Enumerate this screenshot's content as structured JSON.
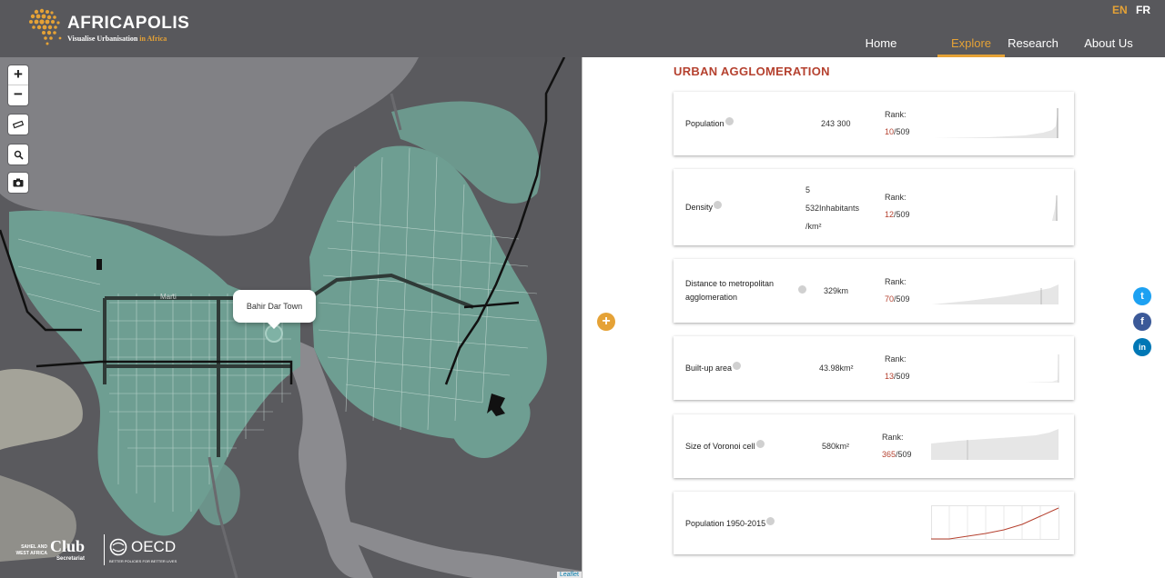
{
  "header": {
    "logo_title": "AFRICAPOLIS",
    "logo_sub_main": "Visualise Urbanisation",
    "logo_sub_highlight": "in Africa",
    "lang_active": "EN",
    "lang_other": "FR",
    "nav": [
      {
        "label": "Home"
      },
      {
        "label": "Explore"
      },
      {
        "label": "Research"
      },
      {
        "label": "About Us"
      }
    ]
  },
  "map": {
    "zoom_in": "+",
    "zoom_out": "−",
    "popup_label": "Bahir Dar Town",
    "road_label": "Marti",
    "attribution": "Leaflet",
    "partner_small": "SAHEL AND WEST AFRICA",
    "partner_club": "Club",
    "partner_secretariat": "Secretariat",
    "partner_oecd": "OECD",
    "partner_oecd_sub": "BETTER POLICIES FOR BETTER LIVES",
    "colors": {
      "background": "#5a5a5e",
      "urban": "#6e9e92",
      "roads": "#d7e7e1",
      "water": "#8b8b8f"
    }
  },
  "panel": {
    "title": "URBAN AGGLOMERATION",
    "toggle": "+",
    "rank_label": "Rank:",
    "cards": [
      {
        "label": "Population",
        "value": "243 300",
        "rank": "10",
        "total": "/509"
      },
      {
        "label": "Density",
        "value_lines": [
          "5",
          "532Inhabitants",
          "/km²"
        ],
        "rank": "12",
        "total": "/509"
      },
      {
        "label_lines": [
          "Distance to metropolitan",
          "agglomeration"
        ],
        "value": "329km",
        "rank": "70",
        "total": "/509"
      },
      {
        "label": "Built-up area",
        "value": "43.98km²",
        "rank": "13",
        "total": "/509"
      },
      {
        "label": "Size of Voronoi cell",
        "value": "580km²",
        "rank": "365",
        "total": "/509"
      },
      {
        "label": "Population 1950-2015"
      }
    ]
  },
  "social": [
    {
      "name": "twitter",
      "glyph": "t",
      "color": "#1da1f2"
    },
    {
      "name": "facebook",
      "glyph": "f",
      "color": "#3b5998"
    },
    {
      "name": "linkedin",
      "glyph": "in",
      "color": "#0077b5"
    }
  ],
  "colors": {
    "accent": "#e5a236",
    "header_bg": "#58585c",
    "title_red": "#b5412f"
  }
}
